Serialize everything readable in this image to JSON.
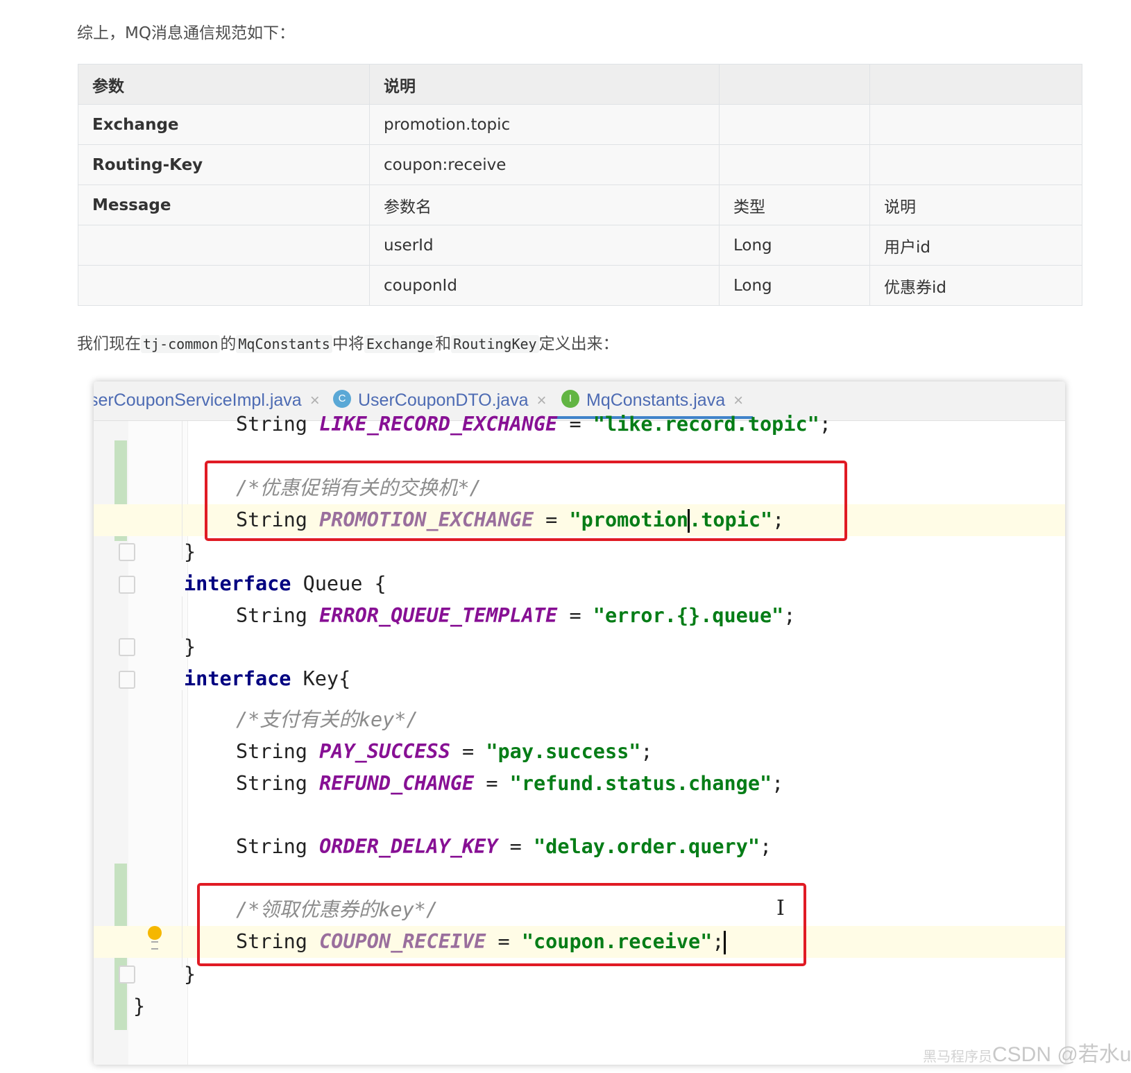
{
  "intro": "综上，MQ消息通信规范如下：",
  "table": {
    "header": [
      "参数",
      "说明",
      "",
      ""
    ],
    "rows": [
      [
        "Exchange",
        "promotion.topic",
        "",
        ""
      ],
      [
        "Routing-Key",
        "coupon:receive",
        "",
        ""
      ],
      [
        "Message",
        "参数名",
        "类型",
        "说明"
      ],
      [
        "",
        "userId",
        "Long",
        "用户id"
      ],
      [
        "",
        "couponId",
        "Long",
        "优惠券id"
      ]
    ]
  },
  "sentence": {
    "p1": "我们现在",
    "c1": "tj-common",
    "p2": "的",
    "c2": "MqConstants",
    "p3": "中将",
    "c3": "Exchange",
    "p4": "和",
    "c4": "RoutingKey",
    "p5": "定义出来："
  },
  "ide": {
    "tabs": [
      {
        "label": "serCouponServiceImpl.java",
        "icon": "",
        "active": false
      },
      {
        "label": "UserCouponDTO.java",
        "icon": "C",
        "active": false
      },
      {
        "label": "MqConstants.java",
        "icon": "I",
        "active": true
      }
    ],
    "code": {
      "l1_type": "String",
      "l1_name": "LIKE_RECORD_EXCHANGE",
      "l1_val": "\"like.record.topic\"",
      "l2_comment": "/*优惠促销有关的交换机*/",
      "l3_type": "String",
      "l3_name": "PROMOTION_EXCHANGE",
      "l3_val_a": "\"promotion",
      "l3_val_b": ".topic\"",
      "l5_kw": "interface",
      "l5_name": "Queue {",
      "l6_type": "String",
      "l6_name": "ERROR_QUEUE_TEMPLATE",
      "l6_val": "\"error.{}.queue\"",
      "l8_kw": "interface",
      "l8_name": "Key{",
      "l9_comment": "/*支付有关的key*/",
      "l10_type": "String",
      "l10_name": "PAY_SUCCESS",
      "l10_val": "\"pay.success\"",
      "l11_type": "String",
      "l11_name": "REFUND_CHANGE",
      "l11_val": "\"refund.status.change\"",
      "l12_type": "String",
      "l12_name": "ORDER_DELAY_KEY",
      "l12_val": "\"delay.order.query\"",
      "l13_comment": "/*领取优惠券的key*/",
      "l14_type": "String",
      "l14_name": "COUPON_RECEIVE",
      "l14_val": "\"coupon.receive\""
    }
  },
  "watermark": {
    "sub": "黑马程序员",
    "main": "CSDN @若水uy"
  },
  "colors": {
    "red_highlight": "#e01b24",
    "string": "#067d17",
    "constant": "#871094",
    "keyword": "#000080",
    "comment": "#8c8c8c"
  }
}
